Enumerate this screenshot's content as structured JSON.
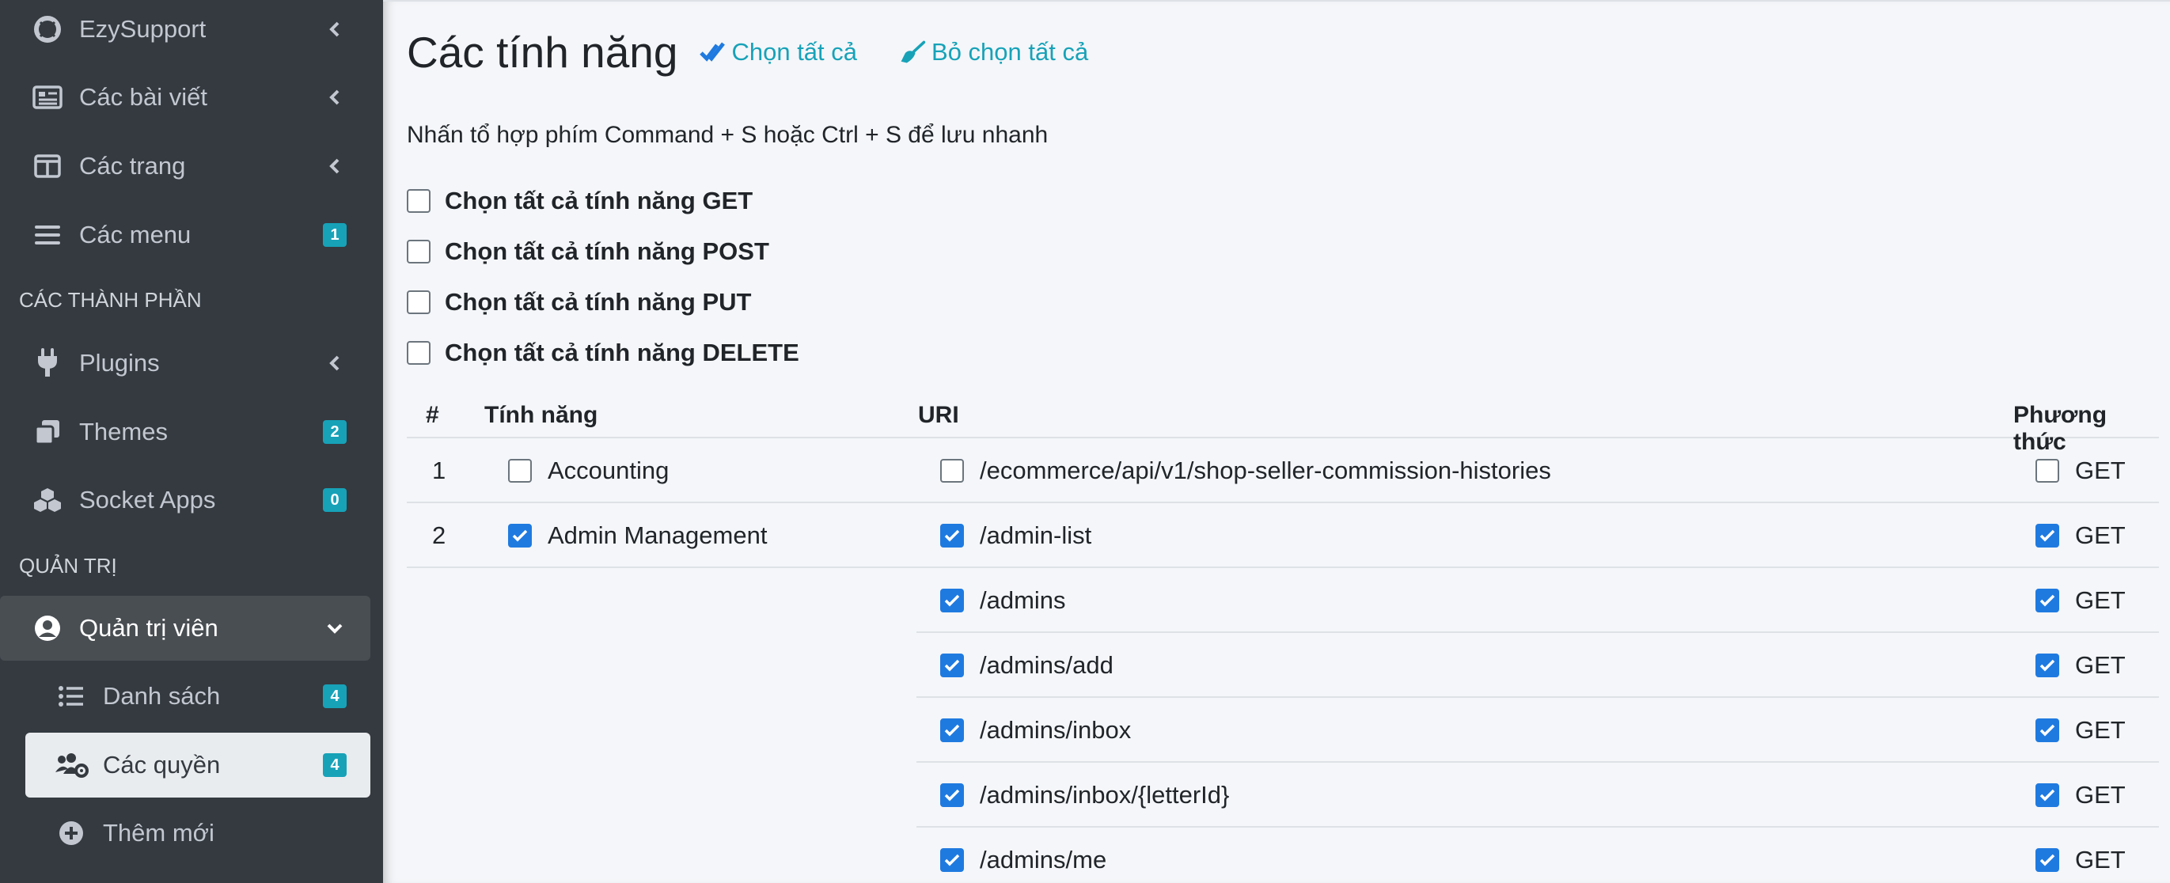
{
  "sidebar": {
    "items": [
      {
        "label": "EzySupport",
        "icon": "lifebuoy-icon"
      },
      {
        "label": "Các bài viết",
        "icon": "newspaper-icon"
      },
      {
        "label": "Các trang",
        "icon": "columns-icon"
      },
      {
        "label": "Các menu",
        "icon": "bars-icon",
        "badge": "1"
      },
      {
        "label": "Plugins",
        "icon": "plug-icon"
      },
      {
        "label": "Themes",
        "icon": "clone-icon",
        "badge": "2"
      },
      {
        "label": "Socket Apps",
        "icon": "cubes-icon",
        "badge": "0"
      },
      {
        "label": "Quản trị viên",
        "icon": "user-circle-icon"
      },
      {
        "label": "Danh sách",
        "icon": "list-icon",
        "badge": "4"
      },
      {
        "label": "Các quyền",
        "icon": "users-cog-icon",
        "badge": "4"
      },
      {
        "label": "Thêm mới",
        "icon": "plus-circle-icon"
      }
    ],
    "headers": [
      "CÁC THÀNH PHẦN",
      "QUẢN TRỊ"
    ]
  },
  "main": {
    "title": "Các tính năng",
    "select_all": "Chọn tất cả",
    "deselect_all": "Bỏ chọn tất cả",
    "hint": "Nhấn tổ hợp phím Command + S hoặc Ctrl + S để lưu nhanh",
    "method_checks": [
      "Chọn tất cả tính năng GET",
      "Chọn tất cả tính năng POST",
      "Chọn tất cả tính năng PUT",
      "Chọn tất cả tính năng DELETE"
    ],
    "table": {
      "headers": {
        "index": "#",
        "feature": "Tính năng",
        "uri": "URI",
        "method": "Phương thức"
      },
      "rows": [
        {
          "index": "1",
          "feature": "Accounting",
          "feature_checked": false,
          "uri": "/ecommerce/api/v1/shop-seller-commission-histories",
          "uri_checked": false,
          "method": "GET",
          "method_checked": false
        },
        {
          "index": "2",
          "feature": "Admin Management",
          "feature_checked": true,
          "uri": "/admin-list",
          "uri_checked": true,
          "method": "GET",
          "method_checked": true
        },
        {
          "uri": "/admins",
          "uri_checked": true,
          "method": "GET",
          "method_checked": true
        },
        {
          "uri": "/admins/add",
          "uri_checked": true,
          "method": "GET",
          "method_checked": true
        },
        {
          "uri": "/admins/inbox",
          "uri_checked": true,
          "method": "GET",
          "method_checked": true
        },
        {
          "uri": "/admins/inbox/{letterId}",
          "uri_checked": true,
          "method": "GET",
          "method_checked": true
        },
        {
          "uri": "/admins/me",
          "uri_checked": true,
          "method": "GET",
          "method_checked": true
        }
      ]
    }
  },
  "colors": {
    "sidebar_bg": "#343a40",
    "accent": "#17a2b8",
    "checkbox": "#1f7ae0"
  }
}
